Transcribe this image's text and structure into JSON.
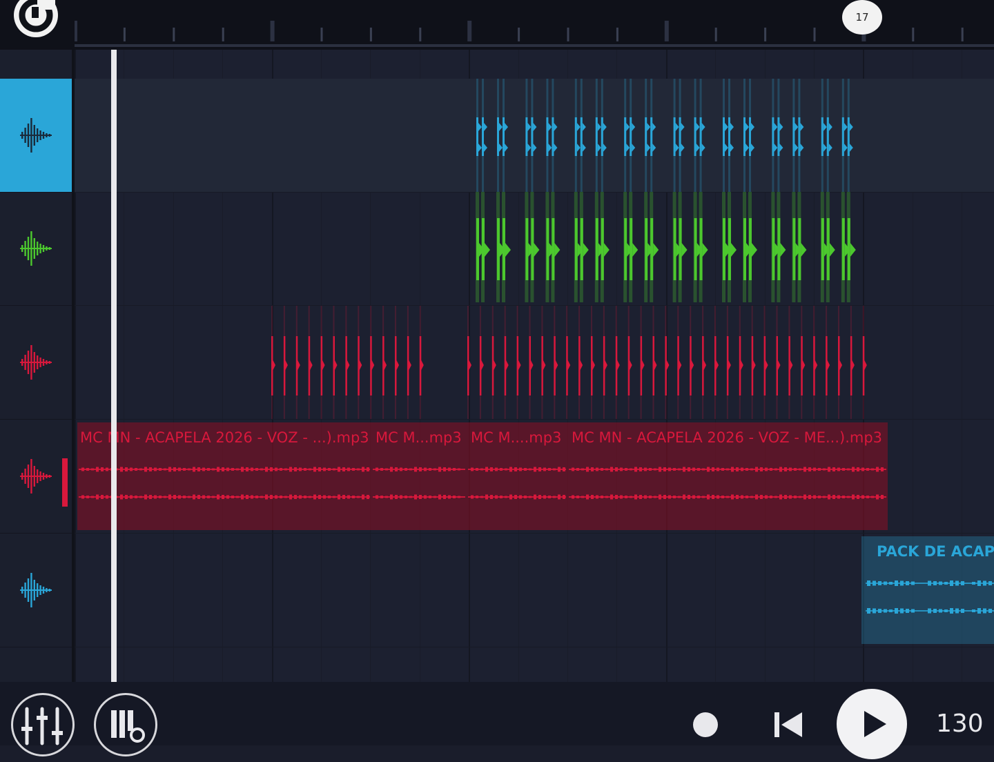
{
  "header": {
    "logo_icon": "app-logo-icon",
    "bar_marker": "17"
  },
  "tracks": [
    {
      "icon": "waveform-icon",
      "color": "#2aa6d8",
      "selected": true
    },
    {
      "icon": "waveform-icon",
      "color": "#4cc82e",
      "selected": false
    },
    {
      "icon": "waveform-icon",
      "color": "#d8183c",
      "selected": false
    },
    {
      "icon": "waveform-icon",
      "color": "#d8183c",
      "selected": false
    },
    {
      "icon": "waveform-icon",
      "color": "#2aa6d8",
      "selected": false
    }
  ],
  "clips": {
    "acapella_labels": [
      "MC MN - ACAPELA 2026 - VOZ - ...).mp3",
      "MC M...mp3",
      "MC M....mp3",
      "MC MN - ACAPELA 2026 - VOZ - ME...).mp3"
    ],
    "pack_label": "PACK DE ACAPEL"
  },
  "transport": {
    "mixer_icon": "mixer-icon",
    "settings_icon": "piano-settings-icon",
    "record_icon": "record-icon",
    "rewind_icon": "skip-to-start-icon",
    "play_icon": "play-icon",
    "tempo": "130"
  },
  "colors": {
    "blue": "#2aa6d8",
    "green": "#4cc82e",
    "red": "#d8183c",
    "background": "#1c2030"
  }
}
